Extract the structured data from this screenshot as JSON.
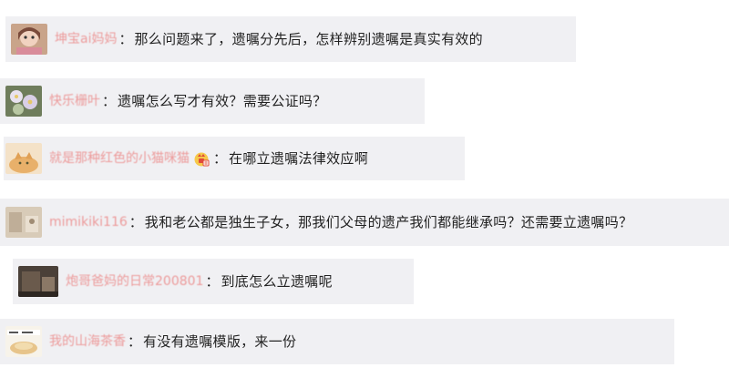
{
  "comments": [
    {
      "username": "坤宝ai妈妈",
      "text": "那么问题来了，遗嘱分先后，怎样辨别遗嘱是真实有效的",
      "avatar": "avatar-doll",
      "has_badge": false
    },
    {
      "username": "快乐栅叶",
      "text": "遗嘱怎么写才有效？需要公证吗？",
      "avatar": "avatar-flowers",
      "has_badge": false
    },
    {
      "username": "就是那种红色的小猫咪猫",
      "text": "在哪立遗嘱法律效应啊",
      "avatar": "avatar-cat",
      "has_badge": true,
      "badge": "vip-badge-icon"
    },
    {
      "username": "mimikiki116",
      "text": "我和老公都是独生子女，那我们父母的遗产我们都能继承吗？还需要立遗嘱吗？",
      "avatar": "avatar-beige",
      "has_badge": false
    },
    {
      "username": "炮哥爸妈的日常200801",
      "text": "到底怎么立遗嘱呢",
      "avatar": "avatar-dark",
      "has_badge": false
    },
    {
      "username": "我的山海茶香",
      "text": "有没有遗嘱模版，来一份",
      "avatar": "avatar-food",
      "has_badge": false
    }
  ],
  "colon": "：",
  "colors": {
    "username": "#ec9a9a",
    "bubble": "#f0f0f3",
    "text": "#222222"
  }
}
